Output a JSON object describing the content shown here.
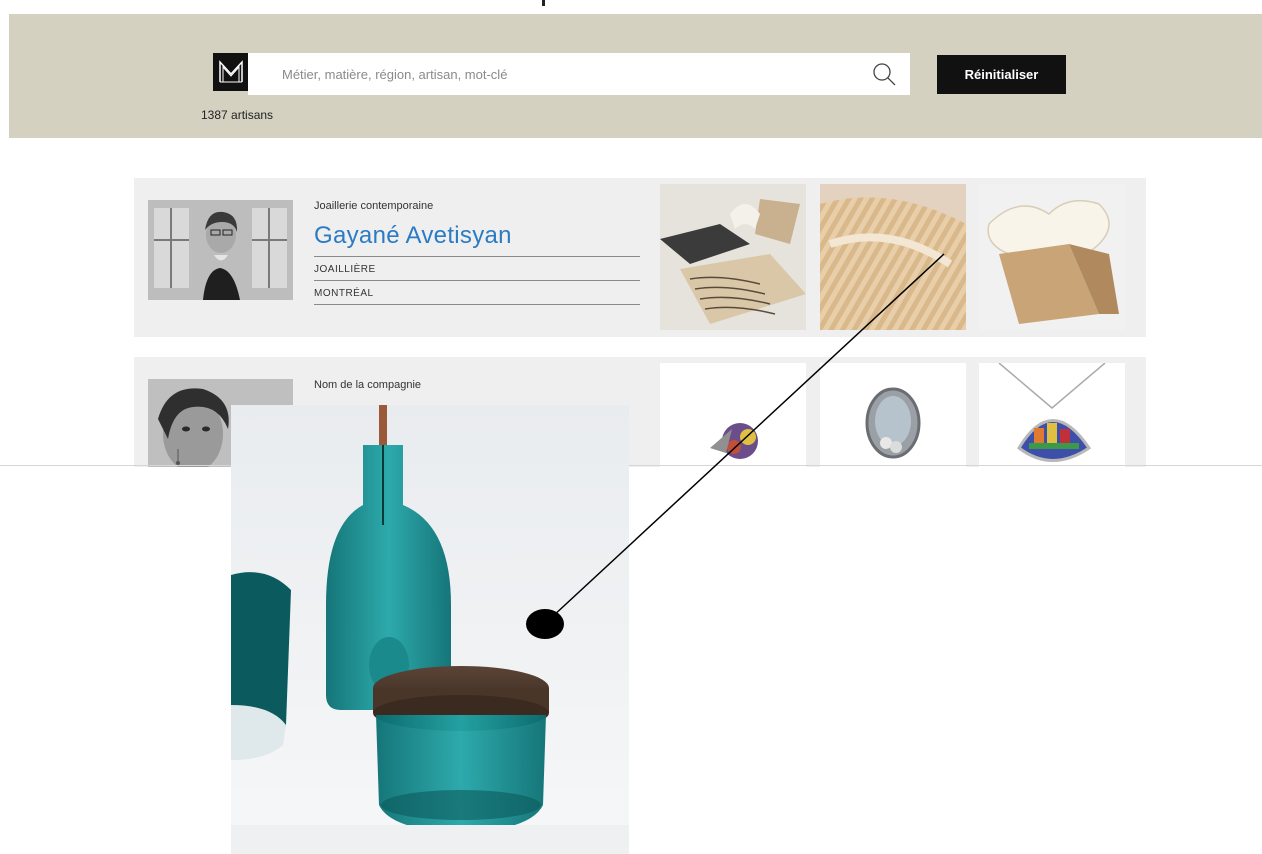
{
  "search": {
    "placeholder": "Métier, matière, région, artisan, mot-clé",
    "reset_label": "Réinitialiser",
    "count_label": "1387 artisans"
  },
  "artisans": [
    {
      "category": "Joaillerie contemporaine",
      "name": "Gayané Avetisyan",
      "trade": "JOAILLIÈRE",
      "city": "MONTRÉAL"
    },
    {
      "category": "Nom de la compagnie"
    }
  ],
  "colors": {
    "band": "#d5d1c1",
    "accent_blue": "#2a7bc4",
    "black": "#111111",
    "card": "#efefef"
  }
}
